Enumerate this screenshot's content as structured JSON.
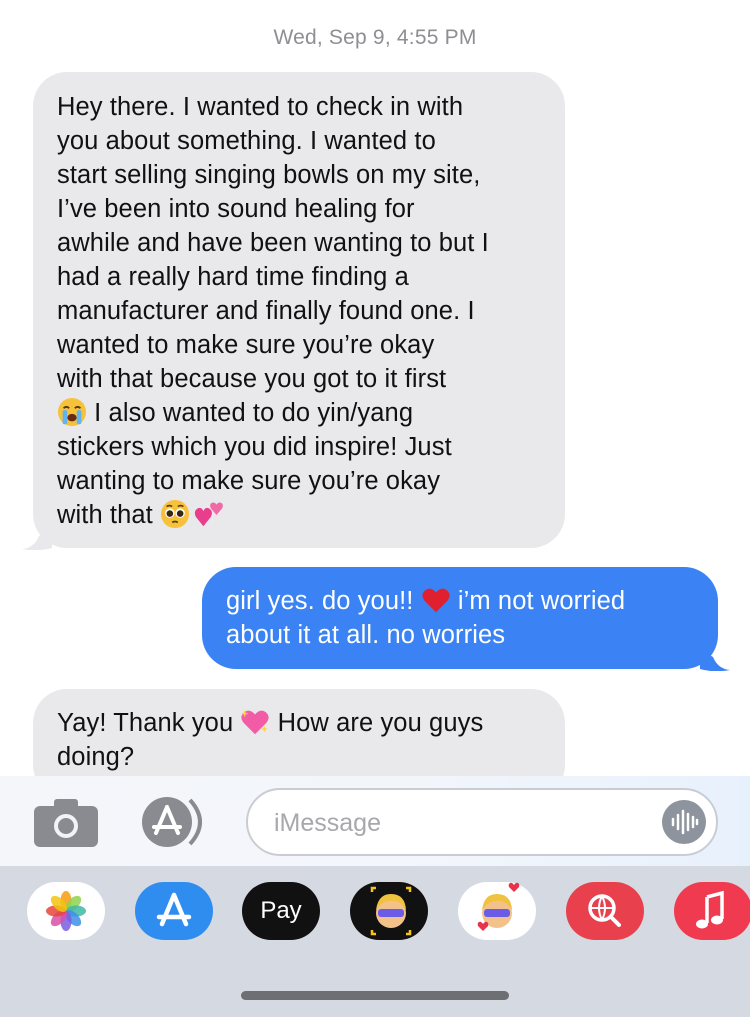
{
  "header": {
    "day_date": "Wed, Sep 9,",
    "time": "4:55 PM"
  },
  "messages": [
    {
      "direction": "incoming",
      "lines": [
        "Hey there. I wanted to check in with",
        "you about something. I wanted to",
        "start selling singing bowls on my site,",
        "I’ve been into sound healing for",
        "awhile and have been wanting to but I",
        "had a really hard time finding a",
        "manufacturer and finally found one. I",
        "wanted to make sure you’re okay",
        "with that because you got to it first",
        " I also wanted to do yin/yang",
        "stickers which you did inspire! Just",
        "wanting to make sure you’re okay",
        "with that "
      ],
      "emojis": [
        "loudly-crying-face",
        "pleading-face",
        "two-hearts"
      ]
    },
    {
      "direction": "outgoing",
      "lines": [
        "girl yes. do you!! ",
        " i’m not worried",
        "about it at all. no worries"
      ],
      "emojis": [
        "red-heart"
      ]
    },
    {
      "direction": "incoming",
      "lines": [
        "Yay! Thank you ",
        " How are you guys",
        "doing?"
      ],
      "emojis": [
        "sparkling-heart"
      ]
    }
  ],
  "composer": {
    "placeholder": "iMessage",
    "camera_icon": "camera-icon",
    "apps_icon": "app-store-icon",
    "voice_icon": "voice-waveform-icon"
  },
  "app_tray": {
    "apps": [
      {
        "name": "photos",
        "icon": "photos-pinwheel-icon"
      },
      {
        "name": "app-store",
        "icon": "app-store-icon"
      },
      {
        "name": "apple-pay",
        "icon": "apple-pay-icon",
        "label_logo": "",
        "label": "Pay"
      },
      {
        "name": "memoji",
        "icon": "memoji-icon"
      },
      {
        "name": "memoji-stickers",
        "icon": "memoji-stickers-icon"
      },
      {
        "name": "image-search",
        "icon": "globe-search-icon"
      },
      {
        "name": "music",
        "icon": "music-note-icon"
      }
    ]
  },
  "colors": {
    "incoming_bubble": "#e9e9eb",
    "outgoing_bubble": "#3b83f4",
    "timestamp": "#8e8e93"
  }
}
